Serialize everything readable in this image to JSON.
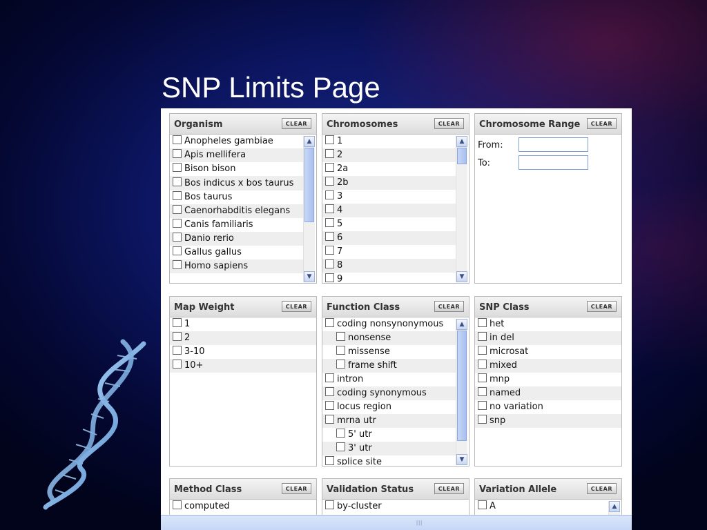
{
  "slide": {
    "title": "SNP Limits Page"
  },
  "clear_label": "CLEAR",
  "panels": {
    "organism": {
      "title": "Organism",
      "items": [
        "Anopheles gambiae",
        "Apis mellifera",
        "Bison bison",
        "Bos indicus x bos taurus",
        "Bos taurus",
        "Caenorhabditis elegans",
        "Canis familiaris",
        "Danio rerio",
        "Gallus gallus",
        "Homo sapiens"
      ]
    },
    "chromosomes": {
      "title": "Chromosomes",
      "items": [
        "1",
        "2",
        "2a",
        "2b",
        "3",
        "4",
        "5",
        "6",
        "7",
        "8",
        "9"
      ]
    },
    "chromosome_range": {
      "title": "Chromosome Range",
      "from_label": "From:",
      "to_label": "To:",
      "from_value": "",
      "to_value": ""
    },
    "map_weight": {
      "title": "Map Weight",
      "items": [
        "1",
        "2",
        "3-10",
        "10+"
      ]
    },
    "function_class": {
      "title": "Function Class",
      "items": [
        "coding nonsynonymous",
        "nonsense",
        "missense",
        "frame shift",
        "intron",
        "coding synonymous",
        "locus region",
        "mrna utr",
        "5' utr",
        "3' utr",
        "splice site"
      ]
    },
    "snp_class": {
      "title": "SNP Class",
      "items": [
        "het",
        "in del",
        "microsat",
        "mixed",
        "mnp",
        "named",
        "no variation",
        "snp"
      ]
    },
    "method_class": {
      "title": "Method Class",
      "items": [
        "computed"
      ]
    },
    "validation_status": {
      "title": "Validation Status",
      "items": [
        "by-cluster"
      ]
    },
    "variation_allele": {
      "title": "Variation Allele",
      "items": [
        "A"
      ]
    }
  }
}
